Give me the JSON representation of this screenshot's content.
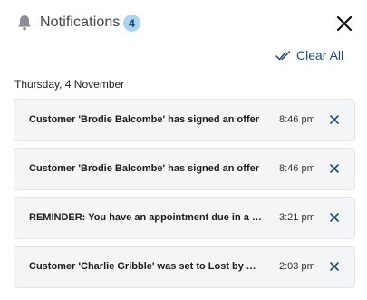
{
  "header": {
    "title": "Notifications",
    "count": "4"
  },
  "actions": {
    "clear_all_label": "Clear All"
  },
  "date_heading": "Thursday, 4 November",
  "notifications": [
    {
      "text": "Customer 'Brodie Balcombe' has signed an offer",
      "time": "8:46 pm"
    },
    {
      "text": "Customer 'Brodie Balcombe' has signed an offer",
      "time": "8:46 pm"
    },
    {
      "text": "REMINDER: You have an appointment due in a few minutes",
      "time": "3:21 pm"
    },
    {
      "text": "Customer 'Charlie Gribble' was set to Lost by Agent",
      "time": "2:03 pm"
    }
  ],
  "colors": {
    "accent": "#1c4a78",
    "badge_bg": "#a9d4f2",
    "card_bg": "#f4f5f6"
  },
  "icons": [
    "bell-icon",
    "close-icon",
    "double-check-icon",
    "dismiss-icon"
  ]
}
